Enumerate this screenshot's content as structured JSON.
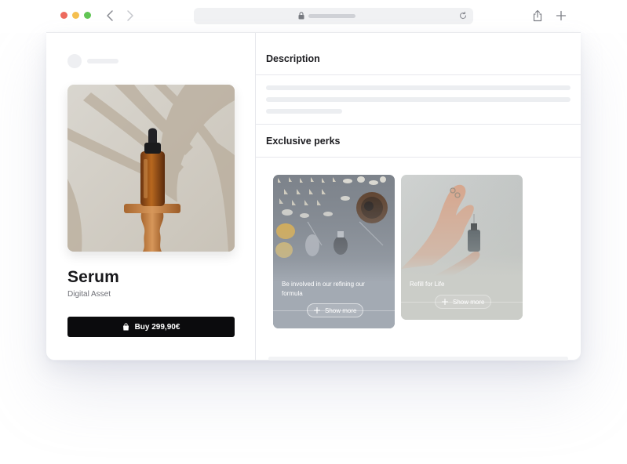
{
  "browser": {
    "traffic_lights": [
      "#ed6a5e",
      "#f5bf4f",
      "#61c554"
    ],
    "icons": {
      "back": "chevron-left-icon",
      "forward": "chevron-right-icon",
      "lock": "lock-icon",
      "reload": "reload-icon",
      "share": "share-icon",
      "new_tab": "plus-icon"
    }
  },
  "product": {
    "title": "Serum",
    "subtitle": "Digital Asset",
    "buy_label": "Buy 299,90€",
    "image": "serum-bottle-photo"
  },
  "sections": {
    "description_title": "Description",
    "perks_title": "Exclusive perks"
  },
  "perks": [
    {
      "text": "Be involved in our refining our formula",
      "button": "Show more"
    },
    {
      "text": "Refill for Life",
      "button": "Show more"
    }
  ],
  "colors": {
    "buy_button": "#0b0b0d",
    "card_one_tint": "#9ea6b0",
    "card_two_tint": "#c9cbc6"
  }
}
